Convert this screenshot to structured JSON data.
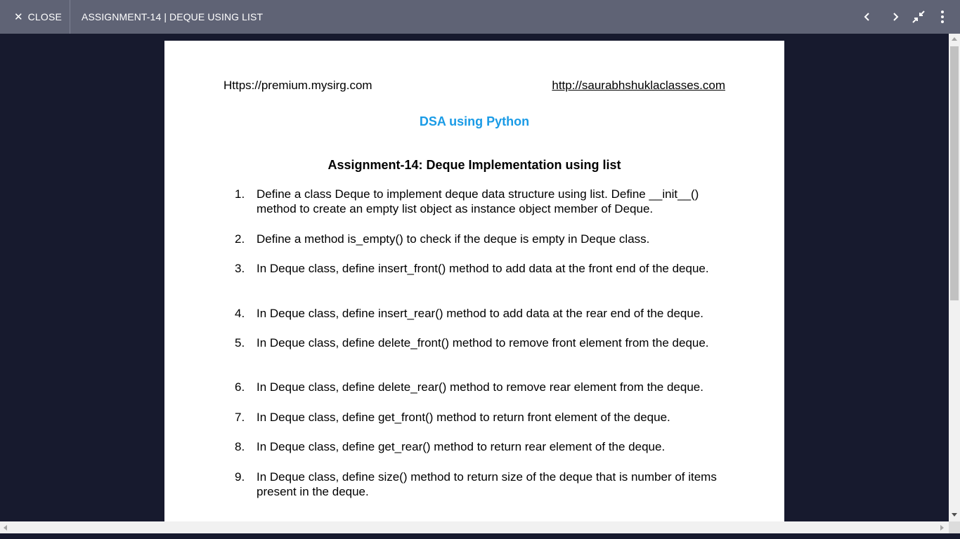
{
  "toolbar": {
    "close_label": "CLOSE",
    "title": "ASSIGNMENT-14 | DEQUE USING LIST",
    "icons": [
      "close-icon",
      "chevron-left-icon",
      "chevron-right-icon",
      "exit-fullscreen-icon",
      "more-vert-icon"
    ]
  },
  "document": {
    "header_left": "Https://premium.mysirg.com",
    "header_right": "http://saurabhshuklaclasses.com",
    "subject": "DSA using Python",
    "heading": "Assignment-14: Deque Implementation using list",
    "items": [
      {
        "num": "1.",
        "text": "Define a class Deque to implement deque data structure using list. Define __init__() method to create an empty list object as instance object member of Deque."
      },
      {
        "num": "2.",
        "text": "Define a method is_empty() to check if the deque is empty in Deque class."
      },
      {
        "num": "3.",
        "text": "In Deque class, define insert_front() method to add data at the front end of the deque."
      },
      {
        "num": "4.",
        "text": "In Deque class, define insert_rear() method to add data at the rear end of the deque."
      },
      {
        "num": "5.",
        "text": "In Deque class, define delete_front() method to remove front element from the deque."
      },
      {
        "num": "6.",
        "text": "In Deque class, define delete_rear() method to remove rear element from the deque."
      },
      {
        "num": "7.",
        "text": "In Deque class, define get_front() method to return front element of the deque."
      },
      {
        "num": "8.",
        "text": "In Deque class, define get_rear() method to return rear element of the deque."
      },
      {
        "num": "9.",
        "text": "In Deque class, define size() method to return size of the deque that is number of items present in the deque."
      }
    ]
  },
  "colors": {
    "toolbar_bg": "#5f6375",
    "viewer_bg": "#171a2e",
    "subject_blue": "#1a9be6",
    "page_bg": "#ffffff"
  }
}
